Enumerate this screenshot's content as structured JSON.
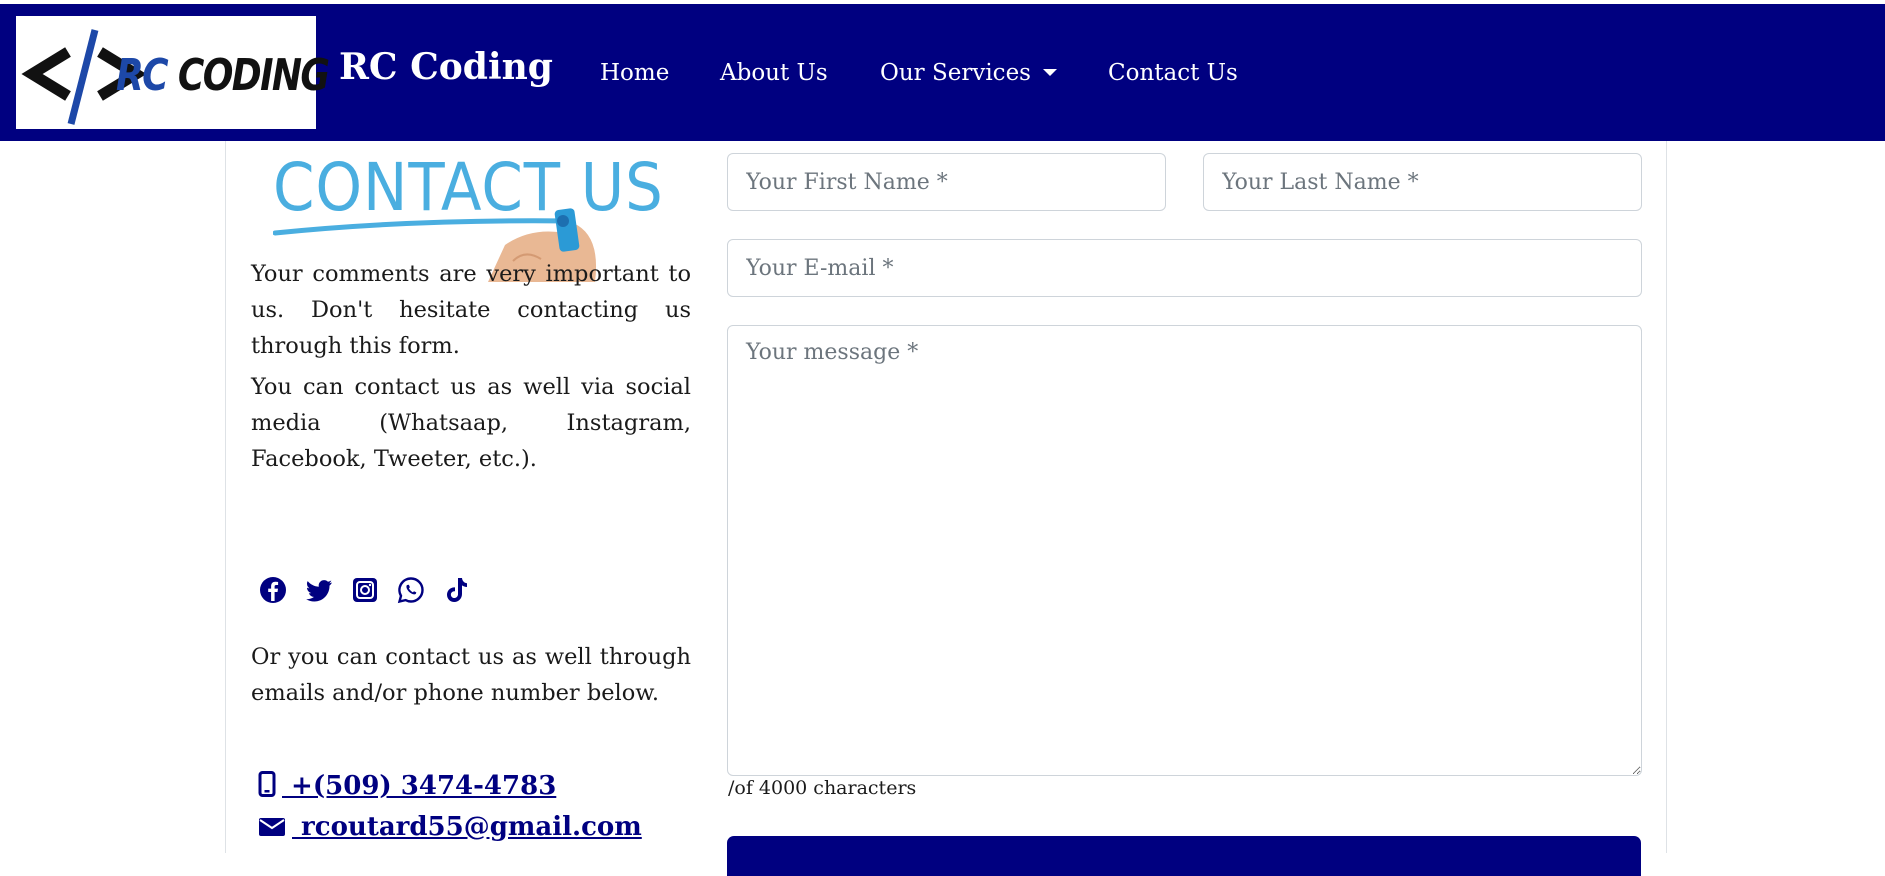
{
  "brand": {
    "logo_text_rc": "RC",
    "logo_text_coding": "CODING",
    "name": "RC Coding",
    "navbar_color": "#000080"
  },
  "nav": {
    "items": [
      {
        "label": "Home"
      },
      {
        "label": "About Us"
      },
      {
        "label": "Our Services"
      },
      {
        "label": "Contact Us"
      }
    ]
  },
  "left": {
    "image_title": "CONTACT US",
    "para1": "Your comments are very important to us. Don't hesitate contacting us through this form.",
    "para2": "You can contact us as well via social media (Whatsaap, Instagram, Facebook, Tweeter, etc.).",
    "social_icons": [
      "facebook-icon",
      "twitter-icon",
      "instagram-icon",
      "whatsapp-icon",
      "tiktok-icon"
    ],
    "para3": "Or you can contact us as well through emails and/or phone number below.",
    "phone": " +(509) 3474-4783",
    "email": " rcoutard55@gmail.com"
  },
  "form": {
    "first_name_placeholder": "Your First Name *",
    "last_name_placeholder": "Your Last Name *",
    "email_placeholder": "Your E-mail *",
    "message_placeholder": "Your message *",
    "counter": "/of 4000 characters"
  }
}
